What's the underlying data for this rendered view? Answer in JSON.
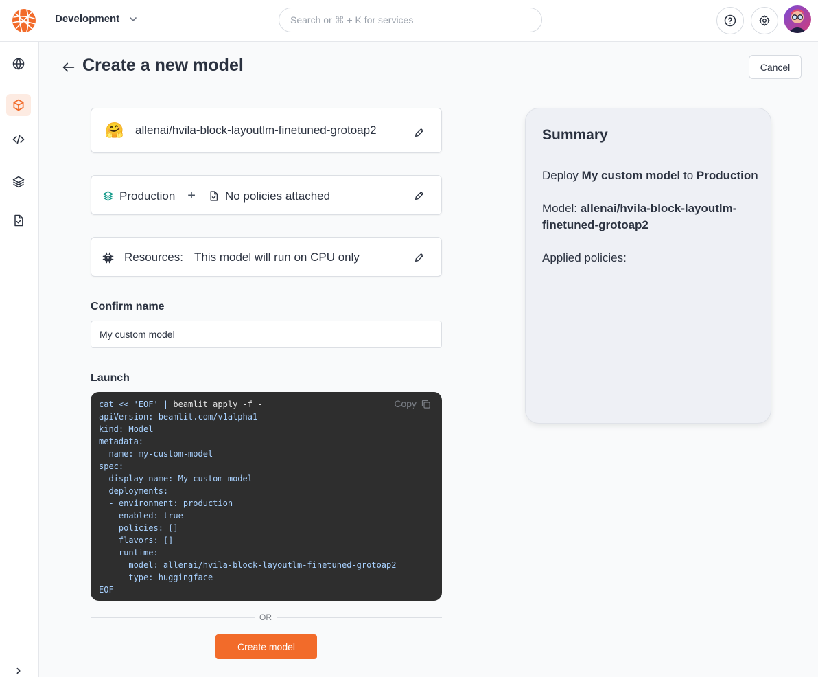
{
  "header": {
    "workspace": "Development",
    "search_placeholder": "Search or ⌘ + K for services"
  },
  "sidebar": {
    "items": [
      {
        "name": "globe-icon"
      },
      {
        "name": "cube-icon",
        "active": true
      },
      {
        "name": "code-icon"
      },
      {
        "name": "layers-icon"
      },
      {
        "name": "file-check-icon"
      }
    ]
  },
  "page": {
    "title": "Create a new model",
    "cancel_label": "Cancel"
  },
  "model_card": {
    "emoji": "🤗",
    "model_name": "allenai/hvila-block-layoutlm-finetuned-grotoap2"
  },
  "env_card": {
    "environment": "Production",
    "plus": "+",
    "policies": "No policies attached"
  },
  "resources_card": {
    "label": "Resources:",
    "value": "This model will run on CPU only"
  },
  "confirm": {
    "label": "Confirm name",
    "value": "My custom model"
  },
  "launch": {
    "label": "Launch",
    "copy_label": "Copy",
    "command_prefix": "cat << 'EOF' | ",
    "command_rest": "beamlit apply -f -",
    "yaml": "apiVersion: beamlit.com/v1alpha1\nkind: Model\nmetadata:\n  name: my-custom-model\nspec:\n  display_name: My custom model\n  deployments:\n  - environment: production\n    enabled: true\n    policies: []\n    flavors: []\n    runtime:\n      model: allenai/hvila-block-layoutlm-finetuned-grotoap2\n      type: huggingface\nEOF"
  },
  "or_text": "OR",
  "create_label": "Create model",
  "summary": {
    "title": "Summary",
    "deploy_prefix": "Deploy",
    "deploy_model": "My custom model",
    "deploy_to": "to",
    "deploy_env": "Production",
    "model_prefix": "Model:",
    "model_value": "allenai/hvila-block-layoutlm-finetuned-grotoap2",
    "applied_policies": "Applied policies:"
  },
  "colors": {
    "accent": "#f26b2a",
    "code_bg": "#2e2e2e",
    "code_text": "#a8d1ff",
    "summary_bg": "#eef0f5"
  }
}
